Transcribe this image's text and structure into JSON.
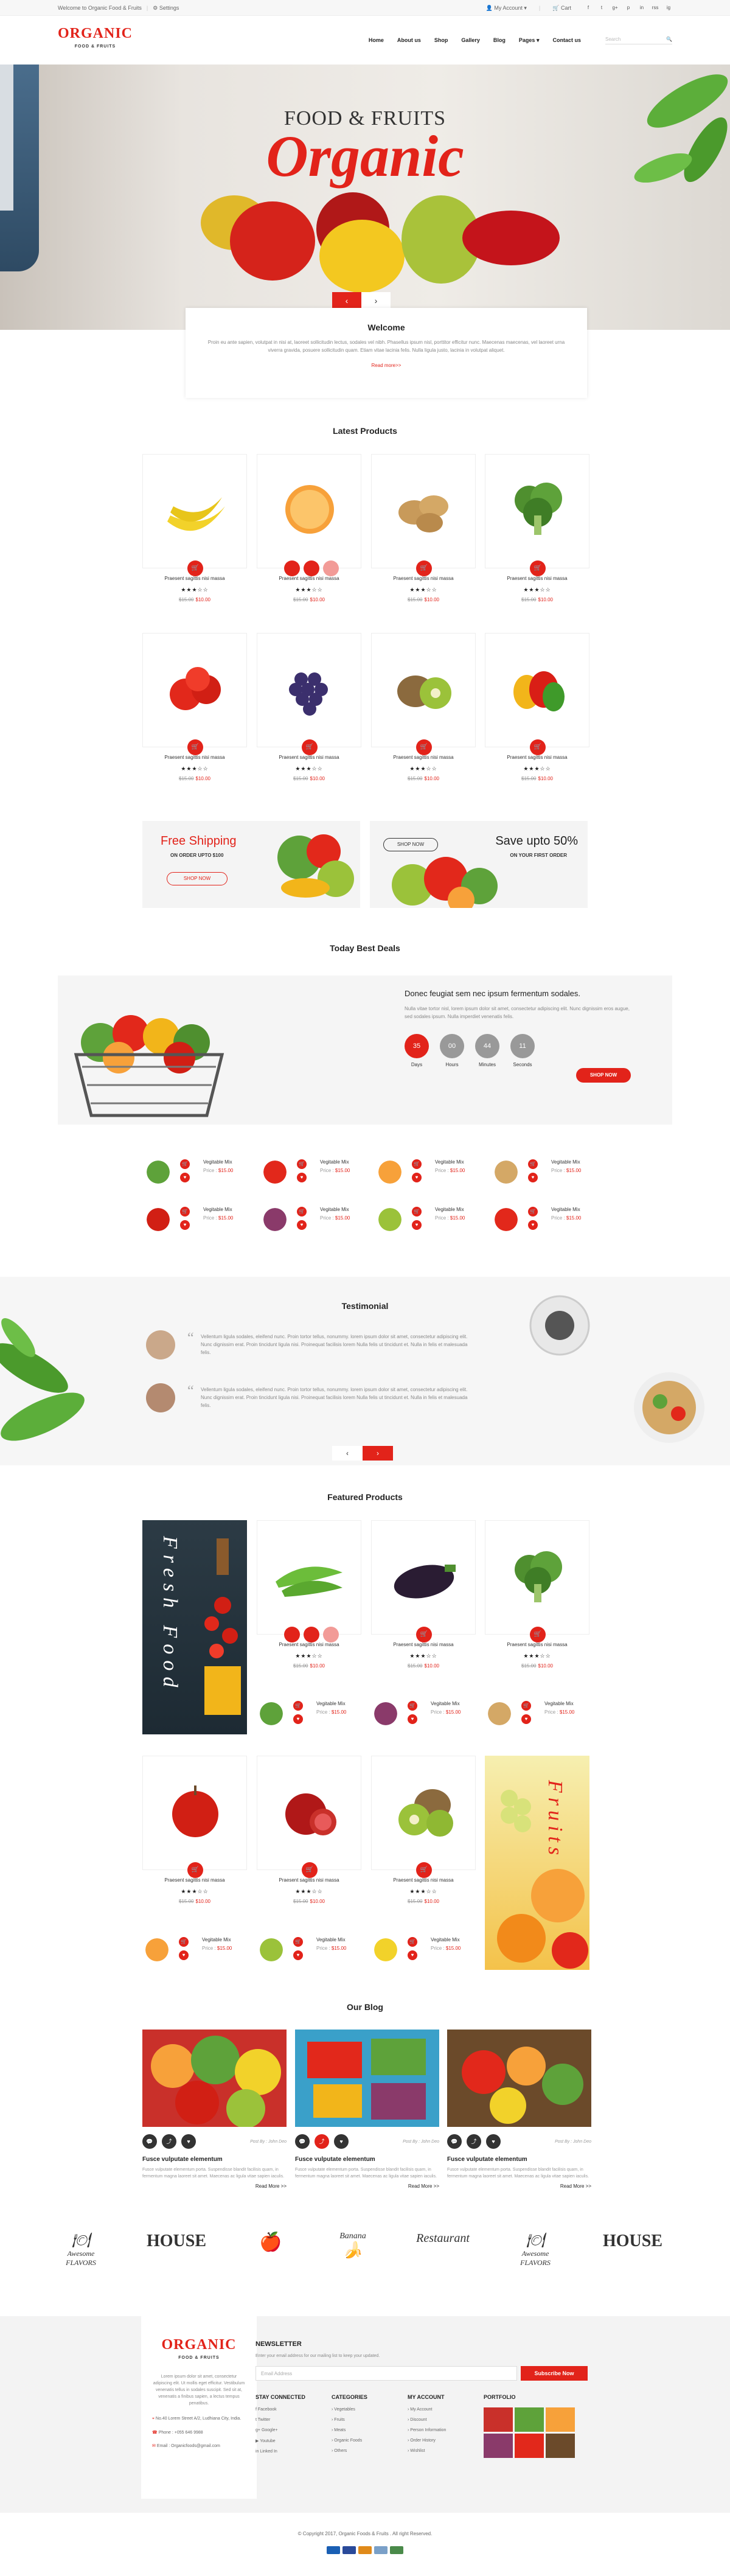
{
  "topbar": {
    "welcome": "Welcome to Organic Food & Fruits",
    "settings": "Settings",
    "account": "My Account",
    "cart": "Cart",
    "socials": [
      "f",
      "t",
      "g+",
      "p",
      "in",
      "rss",
      "ig"
    ]
  },
  "header": {
    "logo": "ORGANIC",
    "logo_sub": "FOOD & FRUITS",
    "nav": [
      "Home",
      "About us",
      "Shop",
      "Gallery",
      "Blog",
      "Pages",
      "Contact us"
    ],
    "search_placeholder": "Search"
  },
  "hero": {
    "subtitle": "FOOD & FRUITS",
    "title": "Organic",
    "prev": "‹",
    "next": "›"
  },
  "welcome": {
    "title": "Welcome",
    "text": "Proin eu ante sapien, volutpat in nisi at, laoreet sollicitudin lectus, sodales vel nibh. Phasellus ipsum nisl, porttitor efficitur nunc. Maecenas maecenas, vel laoreet urna viverra gravida, posuere sollicitudin quam. Etiam vitae lacinia felis. Nulla ligula justo, lacinia in volutpat aliquet.",
    "link": "Read more>>"
  },
  "latest": {
    "title": "Latest Products",
    "product_name": "Praesent sagittis nisi massa",
    "stars": "★★★☆☆",
    "old_price": "$15.00",
    "new_price": "$10.00"
  },
  "banners": {
    "free_title": "Free Shipping",
    "free_sub": "ON ORDER UPTO $100",
    "free_btn": "SHOP NOW",
    "save_title": "Save upto 50%",
    "save_sub": "ON YOUR FIRST ORDER",
    "save_btn": "SHOP NOW"
  },
  "deals": {
    "title": "Today Best Deals",
    "heading": "Donec feugiat sem nec ipsum fermentum sodales.",
    "text": "Nulla vitae tortor nisl, lorem ipsum dolor sit amet, consectetur adipiscing elit. Nunc dignissim eros augue, sed sodales ipsum. Nulla imperdiet venenatis felis.",
    "timer": [
      {
        "value": "35",
        "label": "Days"
      },
      {
        "value": "00",
        "label": "Hours"
      },
      {
        "value": "44",
        "label": "Minutes"
      },
      {
        "value": "11",
        "label": "Seconds"
      }
    ],
    "button": "SHOP NOW",
    "mini_name": "Vegitable Mix",
    "mini_price_label": "Price :",
    "mini_price": "$15.00"
  },
  "testimonial": {
    "title": "Testimonial",
    "text": "Vellentum ligula sodales, eleifend nunc. Proin tortor tellus, nonummy. lorem ipsum dolor sit amet, consectetur adipiscing elit. Nunc dignissim erat. Proin tincidunt ligula nisi. Proinequat facilisis lorem Nulla felis ut tincidunt et. Nulla in felis et malesuada felis.",
    "prev": "‹",
    "next": "›"
  },
  "featured": {
    "title": "Featured Products",
    "side_left": "Fresh Food",
    "side_right": "Fruits"
  },
  "blog": {
    "title": "Our Blog",
    "posts": [
      {
        "title": "Fusce vulputate elementum",
        "by": "Post By : John Deo"
      },
      {
        "title": "Fusce vulputate elementum",
        "by": "Post By : John Deo"
      },
      {
        "title": "Fusce vulputate elementum",
        "by": "Post By : John Deo"
      }
    ],
    "text": "Fusce vulputate elementum porta. Suspendisse blandit facilisis quam, in fermentum magna laoreet sit amet. Maecenas ac ligula vitae sapien iaculis.",
    "more": "Read More >>"
  },
  "brands": [
    "Awesome FLAVORS",
    "HOUSE",
    "",
    "Banana",
    "Restaurant",
    "Awesome FLAVORS",
    "HOUSE"
  ],
  "footer": {
    "about": "Lorem ipsum dolor sit amet, consectetur adipiscing elit. Ut mollis eget efficitur. Vestibulum venenatis tellus in sodales suscipit. Sed sit at, venenatis a finibus sapien, a lectus tempus penatibus.",
    "address": "No.40 Lorem Street A/2, Ludhiana City, India.",
    "phone": "Phone : +055 646 9988",
    "email": "Email : Organicfoods@gmail.com",
    "newsletter_title": "NEWSLETTER",
    "newsletter_text": "Enter your email address for our mailing list to keep your updated.",
    "email_placeholder": "Email Address",
    "subscribe": "Subscribe Now",
    "stay": {
      "title": "STAY CONNECTED",
      "items": [
        "Facebook",
        "Twitter",
        "Google+",
        "Youtube",
        "Linked In"
      ]
    },
    "categories": {
      "title": "CATEGORIES",
      "items": [
        "Vegetables",
        "Fruits",
        "Meats",
        "Organic Foods",
        "Others"
      ]
    },
    "account": {
      "title": "MY ACCOUNT",
      "items": [
        "My Account",
        "Discount",
        "Person Information",
        "Order History",
        "Wishlist"
      ]
    },
    "portfolio": "PORTFOLIO"
  },
  "copyright": "© Copyright 2017, Organic Foods & Fruits . All right Reserved.",
  "colors": {
    "accent": "#e2231a",
    "dark": "#222222"
  }
}
